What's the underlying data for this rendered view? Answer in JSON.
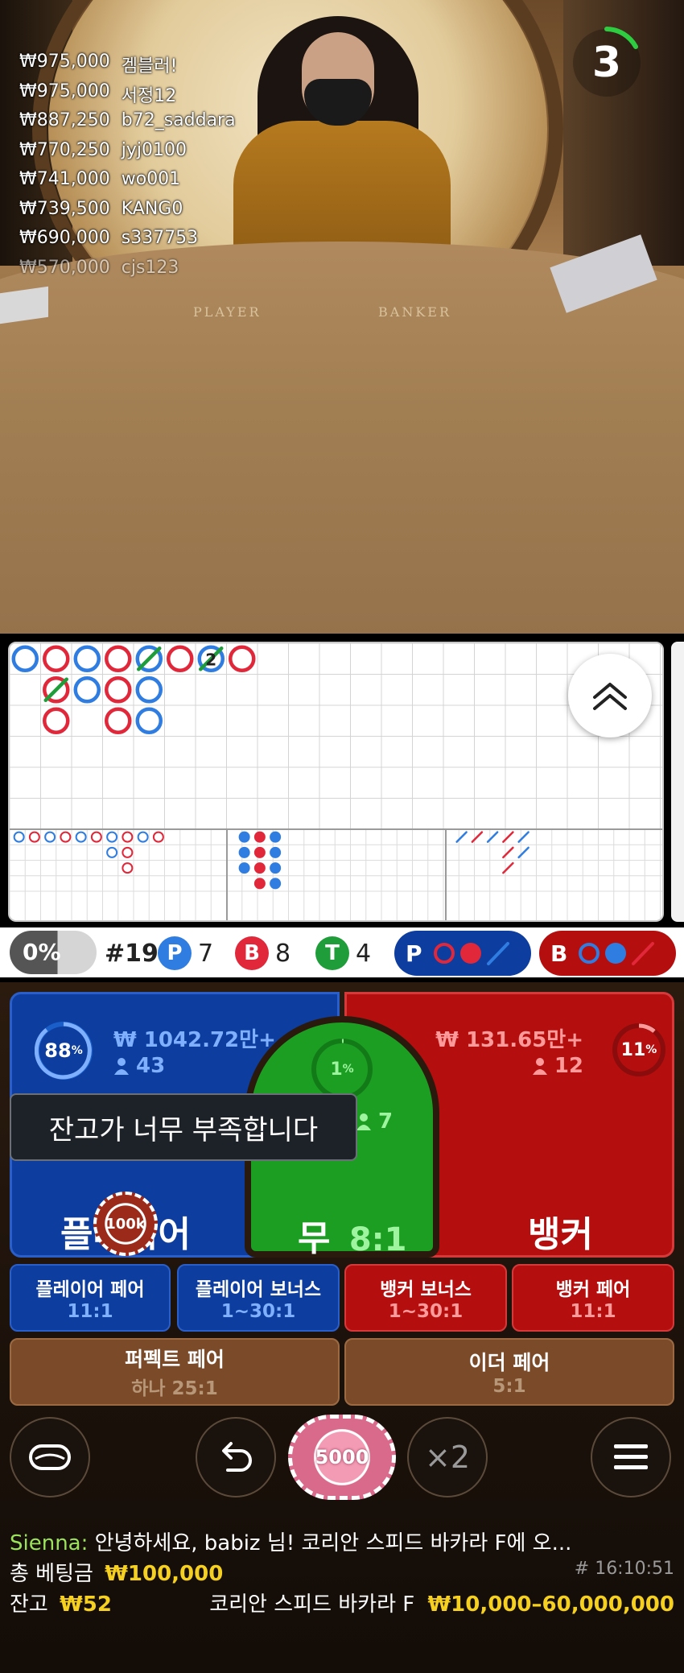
{
  "video": {
    "countdown": "3",
    "table_labels": {
      "player": "PLAYER",
      "banker": "BANKER"
    },
    "winners": [
      {
        "amount": "₩975,000",
        "name": "겜블러!"
      },
      {
        "amount": "₩975,000",
        "name": "서정12"
      },
      {
        "amount": "₩887,250",
        "name": "b72_saddara"
      },
      {
        "amount": "₩770,250",
        "name": "jyj0100"
      },
      {
        "amount": "₩741,000",
        "name": "wo001"
      },
      {
        "amount": "₩739,500",
        "name": "KANG0"
      },
      {
        "amount": "₩690,000",
        "name": "s337753"
      },
      {
        "amount": "₩570,000",
        "name": "cjs123"
      }
    ]
  },
  "roadmap": {
    "big_road_label": "2",
    "colors": {
      "player": "#2f7de1",
      "banker": "#e0283a",
      "tie": "#1f9d3a"
    }
  },
  "stats": {
    "percent": "0%",
    "round": "#19",
    "player_badge": "P",
    "player_count": "7",
    "banker_badge": "B",
    "banker_count": "8",
    "tie_badge": "T",
    "tie_count": "4",
    "player_predict": "P",
    "banker_predict": "B"
  },
  "bets": {
    "player": {
      "percent": "88",
      "percent_sign": "%",
      "amount": "₩ 1042.72만+",
      "players": "43",
      "name": "플레이어",
      "color": "#0d3d9e"
    },
    "tie": {
      "percent": "1",
      "percent_sign": "%",
      "players": "7",
      "name": "무",
      "odds": "8:1",
      "color": "#1c9e22"
    },
    "banker": {
      "percent": "11",
      "percent_sign": "%",
      "amount": "₩ 131.65만+",
      "players": "12",
      "name": "뱅커",
      "color": "#b50e0e"
    },
    "toast": "잔고가 너무 부족합니다",
    "placed_chip": "100k",
    "side_bets": [
      {
        "name": "플레이어 페어",
        "odds": "11:1"
      },
      {
        "name": "플레이어 보너스",
        "odds": "1~30:1"
      },
      {
        "name": "뱅커 보너스",
        "odds": "1~30:1"
      },
      {
        "name": "뱅커 페어",
        "odds": "11:1"
      }
    ],
    "perfect_pair": {
      "name": "퍼펙트 페어",
      "odds": "하나 25:1"
    },
    "either_pair": {
      "name": "이더 페어",
      "odds": "5:1"
    }
  },
  "controls": {
    "chip_value": "5000",
    "double_label": "×2"
  },
  "footer": {
    "chat_user": "Sienna:",
    "chat_message": "안녕하세요, babiz 님! 코리안 스피드 바카라 F에 오...",
    "total_bet_label": "총 베팅금",
    "total_bet_value": "₩100,000",
    "round_id": "# 16:10:51",
    "balance_label": "잔고",
    "balance_value": "₩52",
    "table_name": "코리안 스피드 바카라 F",
    "limits": "₩10,000–60,000,000"
  }
}
